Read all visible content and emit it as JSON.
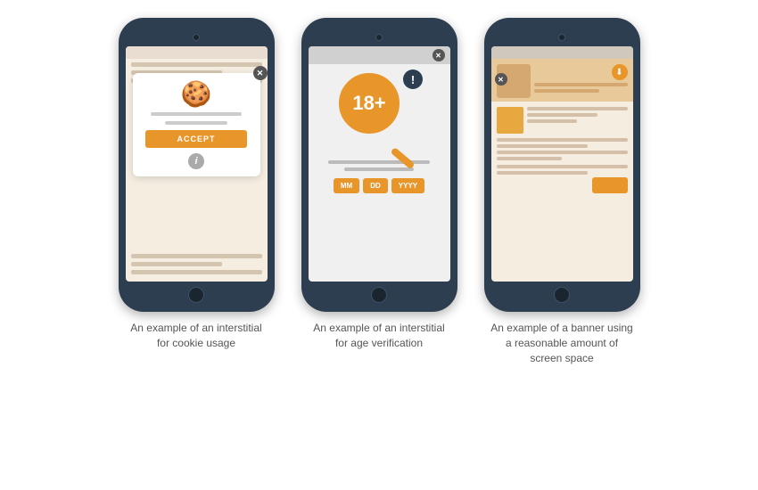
{
  "phones": [
    {
      "id": "phone-1",
      "type": "cookie-interstitial",
      "modal": {
        "accept_label": "ACCEPT",
        "info_label": "i"
      },
      "caption": "An example of an interstitial for cookie usage"
    },
    {
      "id": "phone-2",
      "type": "age-verification",
      "age_label": "18+",
      "date_fields": [
        "MM",
        "DD",
        "YYYY"
      ],
      "warning": "!",
      "close_label": "x",
      "caption": "An example of an interstitial for age verification"
    },
    {
      "id": "phone-3",
      "type": "banner",
      "close_label": "x",
      "caption": "An example of a banner using a reasonable amount of screen space"
    }
  ],
  "colors": {
    "orange": "#e8952a",
    "phone_bg": "#2c3e50",
    "cream": "#f5ede0",
    "modal_bg": "#ffffff"
  }
}
